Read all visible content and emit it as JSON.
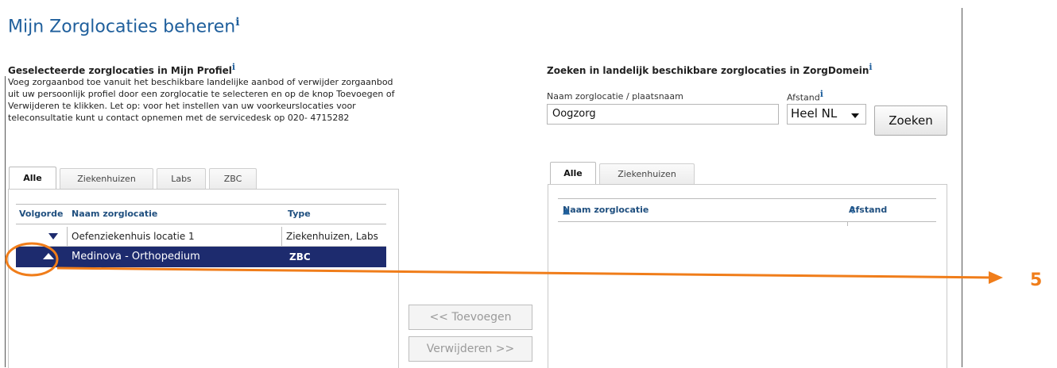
{
  "page": {
    "title": "Mijn Zorglocaties beheren",
    "info_glyph": "i"
  },
  "left": {
    "title": "Geselecteerde zorglocaties in Mijn Profiel",
    "description": "Voeg zorgaanbod toe vanuit het beschikbare landelijke aanbod of verwijder zorgaanbod uit uw persoonlijk profiel door een zorglocatie te selecteren en op de knop Toevoegen of Verwijderen te klikken. Let op: voor het instellen van uw voorkeurslocaties voor teleconsultatie kunt u contact opnemen met de servicedesk op 020- 4715282",
    "tabs": [
      "Alle",
      "Ziekenhuizen",
      "Labs",
      "ZBC"
    ],
    "columns": [
      "Volgorde",
      "Naam zorglocatie",
      "Type"
    ],
    "rows": [
      {
        "name": "Oefenziekenhuis locatie 1",
        "type": "Ziekenhuizen, Labs",
        "order_icon": "arrow-down-icon"
      },
      {
        "name": "Medinova - Orthopedium",
        "type": "ZBC",
        "order_icon": "arrow-up-icon",
        "selected": true
      }
    ]
  },
  "middle": {
    "add_label": "<< Toevoegen",
    "remove_label": "Verwijderen >>"
  },
  "right": {
    "title": "Zoeken in landelijk beschikbare zorglocaties in ZorgDomein",
    "name_label": "Naam zorglocatie / plaatsnaam",
    "name_value": "Oogzorg",
    "distance_label": "Afstand",
    "distance_value": "Heel NL",
    "search_label": "Zoeken",
    "tabs": [
      "Alle",
      "Ziekenhuizen"
    ],
    "columns": [
      "Naam zorglocatie",
      "Afstand"
    ]
  },
  "annotation": {
    "number": "5",
    "color": "#f07d1a"
  },
  "colors": {
    "title_blue": "#1f5f9c",
    "selected_row": "#1d2b6e"
  }
}
